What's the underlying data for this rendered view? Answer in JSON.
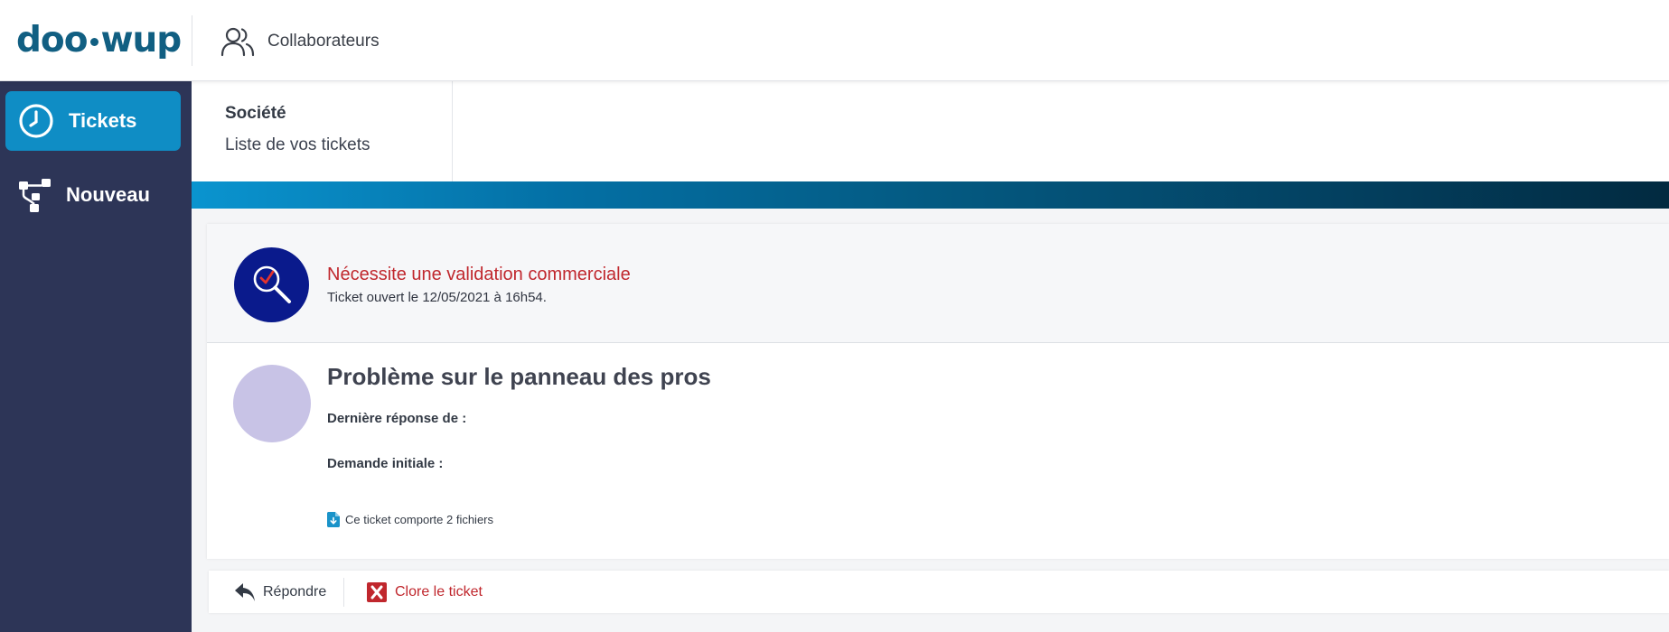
{
  "header": {
    "logo": {
      "part1": "doo",
      "part2": "wup"
    },
    "nav_item": {
      "label": "Collaborateurs",
      "icon": "users-icon"
    }
  },
  "sidebar": {
    "items": [
      {
        "label": "Tickets",
        "icon": "clock-icon",
        "active": true
      },
      {
        "label": "Nouveau",
        "icon": "hierarchy-icon",
        "active": false
      }
    ]
  },
  "subheader": {
    "company": "Société",
    "subtitle": "Liste de vos tickets"
  },
  "ticket": {
    "status": {
      "title": "Nécessite une validation commerciale",
      "opened": "Ticket ouvert le 12/05/2021 à 16h54.",
      "icon": "magnifier-check-icon"
    },
    "title": "Problème sur le panneau des pros",
    "last_reply_label": "Dernière réponse de :",
    "initial_request_label": "Demande initiale :",
    "files_text": "Ce ticket comporte 2 fichiers"
  },
  "actions": {
    "reply": "Répondre",
    "close": "Clore le ticket"
  },
  "colors": {
    "brand": "#115f82",
    "sidebar": "#2d3557",
    "active": "#0f8dc5",
    "status_red": "#c0272d",
    "status_circle": "#0a1a8c",
    "avatar": "#c8c3e6"
  }
}
